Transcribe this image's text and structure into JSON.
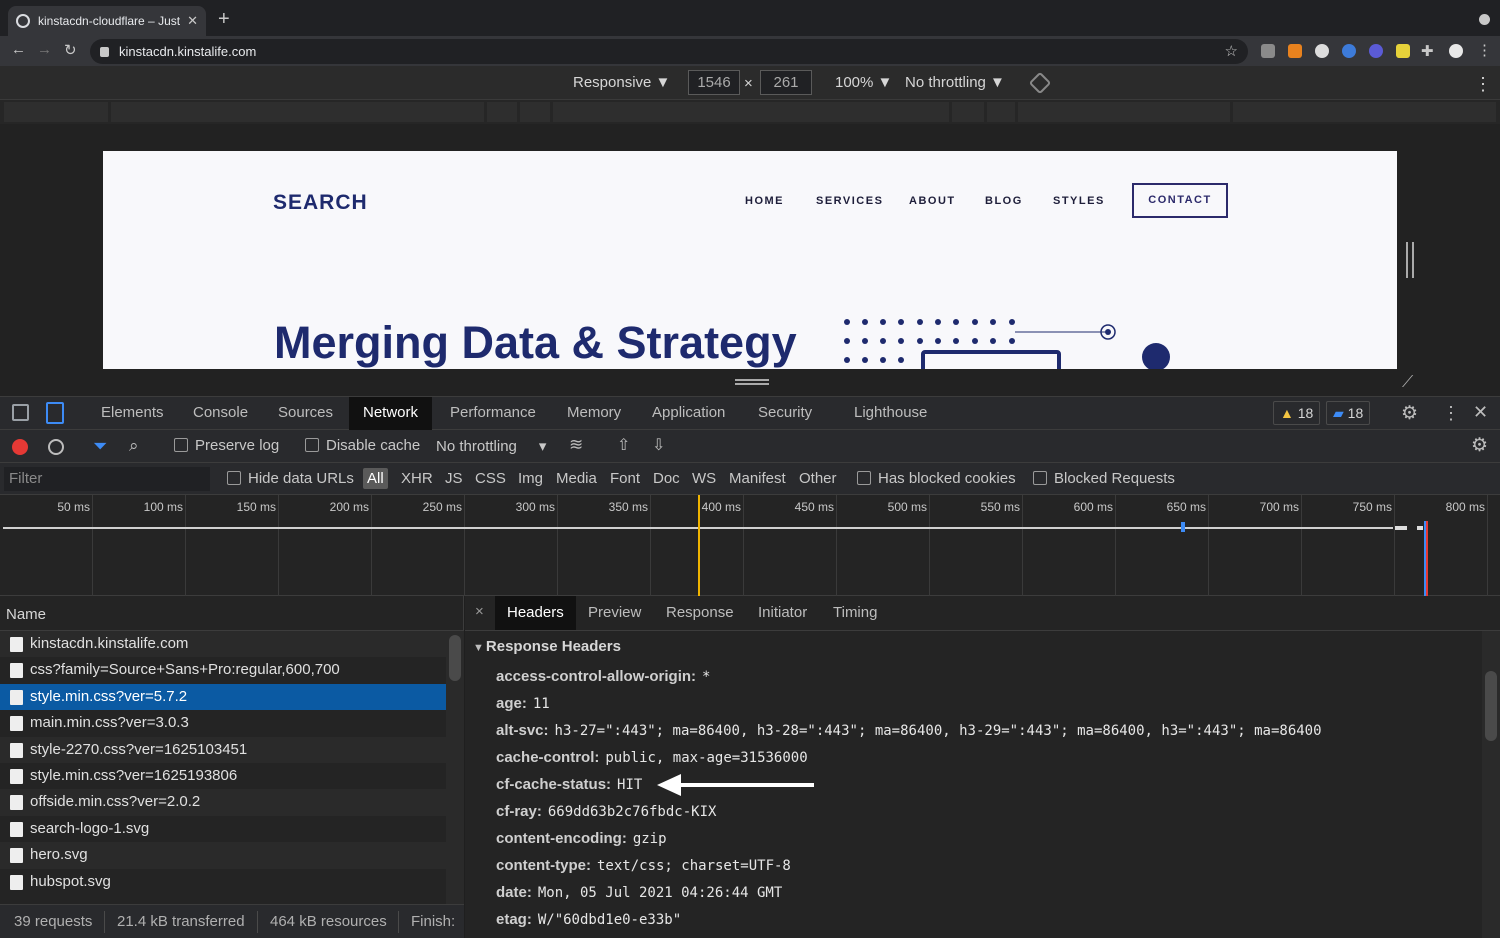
{
  "browser": {
    "tab_title": "kinstacdn-cloudflare – Just an...",
    "url": "kinstacdn.kinstalife.com",
    "new_tab": "+"
  },
  "device_toolbar": {
    "mode": "Responsive ▼",
    "width": "1546",
    "times": "×",
    "height": "261",
    "zoom": "100% ▼",
    "throttling": "No throttling ▼"
  },
  "site": {
    "logo": "SEARCH",
    "nav": [
      "HOME",
      "SERVICES",
      "ABOUT",
      "BLOG",
      "STYLES"
    ],
    "contact": "CONTACT",
    "hero_title": "Merging Data & Strategy"
  },
  "devtools": {
    "tabs": [
      "Elements",
      "Console",
      "Sources",
      "Network",
      "Performance",
      "Memory",
      "Application",
      "Security",
      "Lighthouse"
    ],
    "active_tab": "Network",
    "warnings": "18",
    "messages": "18",
    "preserve_log": "Preserve log",
    "disable_cache": "Disable cache",
    "throttling": "No throttling",
    "filter_placeholder": "Filter",
    "hide_data_urls": "Hide data URLs",
    "filter_types": [
      "All",
      "XHR",
      "JS",
      "CSS",
      "Img",
      "Media",
      "Font",
      "Doc",
      "WS",
      "Manifest",
      "Other"
    ],
    "has_blocked_cookies": "Has blocked cookies",
    "blocked_requests": "Blocked Requests",
    "timeline_ticks": [
      "50 ms",
      "100 ms",
      "150 ms",
      "200 ms",
      "250 ms",
      "300 ms",
      "350 ms",
      "400 ms",
      "450 ms",
      "500 ms",
      "550 ms",
      "600 ms",
      "650 ms",
      "700 ms",
      "750 ms",
      "800 ms"
    ],
    "name_header": "Name",
    "requests": [
      "kinstacdn.kinstalife.com",
      "css?family=Source+Sans+Pro:regular,600,700",
      "style.min.css?ver=5.7.2",
      "main.min.css?ver=3.0.3",
      "style-2270.css?ver=1625103451",
      "style.min.css?ver=1625193806",
      "offside.min.css?ver=2.0.2",
      "search-logo-1.svg",
      "hero.svg",
      "hubspot.svg"
    ],
    "selected_request_index": 2,
    "status": {
      "requests": "39 requests",
      "transferred": "21.4 kB transferred",
      "resources": "464 kB resources",
      "finish": "Finish:"
    },
    "detail_tabs": [
      "Headers",
      "Preview",
      "Response",
      "Initiator",
      "Timing"
    ],
    "detail_active": "Headers",
    "close": "×",
    "section_title": "Response Headers",
    "headers": [
      {
        "key": "access-control-allow-origin:",
        "value": "*"
      },
      {
        "key": "age:",
        "value": "11"
      },
      {
        "key": "alt-svc:",
        "value": "h3-27=\":443\"; ma=86400, h3-28=\":443\"; ma=86400, h3-29=\":443\"; ma=86400, h3=\":443\"; ma=86400"
      },
      {
        "key": "cache-control:",
        "value": "public, max-age=31536000"
      },
      {
        "key": "cf-cache-status:",
        "value": "HIT"
      },
      {
        "key": "cf-ray:",
        "value": "669dd63b2c76fbdc-KIX"
      },
      {
        "key": "content-encoding:",
        "value": "gzip"
      },
      {
        "key": "content-type:",
        "value": "text/css; charset=UTF-8"
      },
      {
        "key": "date:",
        "value": "Mon, 05 Jul 2021 04:26:44 GMT"
      },
      {
        "key": "etag:",
        "value": "W/\"60dbd1e0-e33b\""
      }
    ]
  },
  "colors": {
    "selected_row": "#0b5aa3",
    "site_navy": "#1e2a6e",
    "record": "#e53935"
  }
}
